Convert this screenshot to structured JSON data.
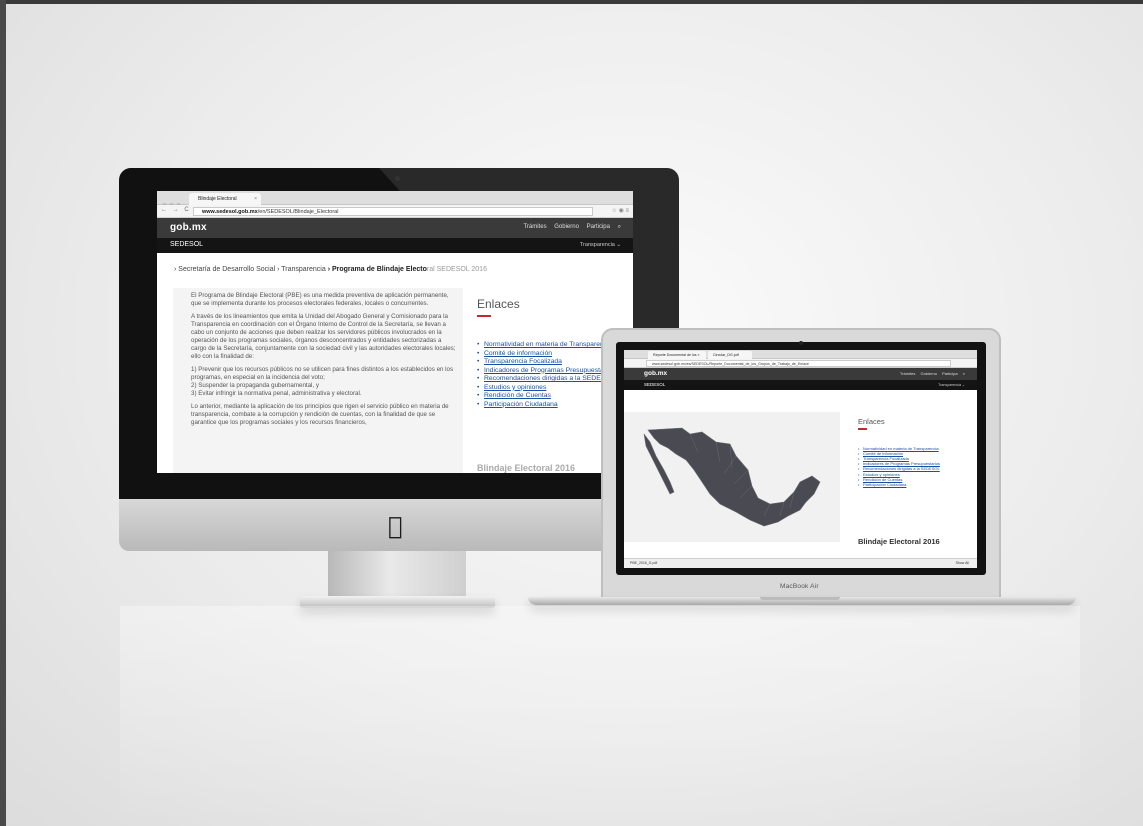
{
  "imac": {
    "browser": {
      "tab_title": "Blindaje Electoral",
      "url_domain": "www.sedesol.gob.mx",
      "url_path": "/en/SEDESOL/Blindaje_Electoral",
      "nav_buttons": "← → C",
      "right_icons": "☆ ◉ ≡"
    },
    "site": {
      "logo": "gob.mx",
      "nav": [
        "Trámites",
        "Gobierno",
        "Participa"
      ],
      "section": "SEDESOL",
      "section_menu": "Transparencia ⌄"
    },
    "breadcrumb": {
      "part1": "› Secretaría de Desarrollo Social",
      "part2": "› Transparencia",
      "current": "› Programa de Blindaje Electo",
      "current_faded": "ral SEDESOL 2016"
    },
    "article": {
      "p1": "El Programa de Blindaje Electoral (PBE) es una medida preventiva de aplicación permanente, que se implementa durante los procesos electorales federales, locales o concurrentes.",
      "p2": "A través de los lineamientos que emita la Unidad del Abogado General y Comisionado para la Transparencia en coordinación con el Órgano Interno de Control de la Secretaría, se llevan a cabo un conjunto de acciones que deben realizar los servidores públicos involucrados en la operación de los programas sociales, órganos desconcentrados y entidades sectorizadas a cargo de la Secretaría, conjuntamente con la sociedad civil y las autoridades electorales locales; ello con la finalidad de:",
      "p3a": "1) Prevenir que los recursos públicos no se utilicen para fines distintos a los establecidos en los programas, en especial en la incidencia del voto;",
      "p3b": "2) Suspender la propaganda gubernamental, y",
      "p3c": "3) Evitar infringir la normativa penal, administrativa y electoral.",
      "p4": "Lo anterior, mediante la aplicación de los principios que rigen el servicio público en materia de transparencia, combate a la corrupción y rendición de cuentas, con la finalidad de que se garantice que los programas sociales y los recursos financieros,"
    },
    "enlaces": {
      "title": "Enlaces",
      "items": [
        "Normatividad en materia de Transparencia",
        "Comité de información",
        "Transparencia Focalizada",
        "Indicadores de Programas Presupuestarios",
        "Recomendaciones dirigidas a la SEDESOL",
        "Estudios y opiniones",
        "Rendición de Cuentas",
        "Participación Ciudadana"
      ],
      "footer_faded": "Blindaje Electoral 2016"
    },
    "logo_glyph": ""
  },
  "macbook": {
    "label": "MacBook Air",
    "browser": {
      "tab1": "Reporte Documental de los ×",
      "tab2": "Circular_DG.pdf",
      "url": "www.sedesol.gob.mx/es/SEDESOL/Reporte_Documental_de_los_Grupos_de_Trabajo_de_Enlace"
    },
    "site": {
      "logo": "gob.mx",
      "nav": [
        "Trámites",
        "Gobierno",
        "Participa"
      ],
      "section": "SEDESOL",
      "section_menu": "Transparencia ⌄"
    },
    "enlaces": {
      "title": "Enlaces",
      "items": [
        "Normatividad en materia de Transparencia",
        "Comité de información",
        "Transparencia Focalizada",
        "Indicadores de Programas Presupuestarios",
        "Recomendaciones dirigidas a la SEDESOL",
        "Estudios y opiniones",
        "Rendición de Cuentas",
        "Participación Ciudadana"
      ]
    },
    "heading": "Blindaje Electoral 2016",
    "download": {
      "file": "PBE_2016_G.pdf",
      "show_all": "Show All"
    }
  },
  "colors": {
    "header": "#3a3a3a",
    "subheader": "#141414",
    "link": "#1a4fa6",
    "accent": "#c0292d",
    "map": "#4a4a52"
  }
}
